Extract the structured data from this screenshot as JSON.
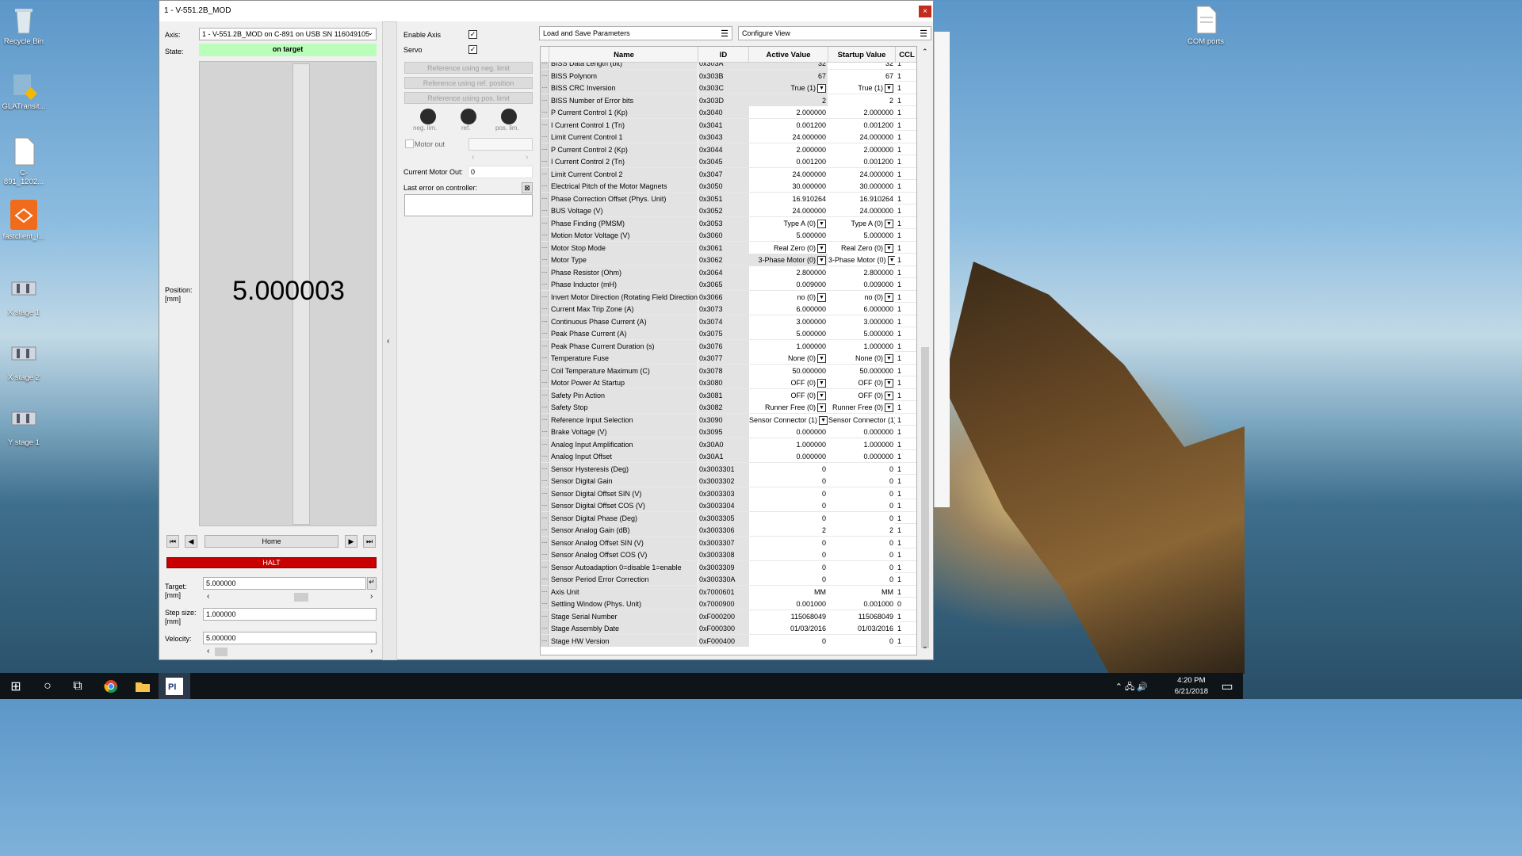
{
  "desktop": {
    "icons": [
      {
        "label": "Recycle Bin",
        "icon": "recycle-bin-icon"
      },
      {
        "label": "GLATransit...",
        "icon": "app-icon"
      },
      {
        "label": "C-891_1202...",
        "icon": "file-icon"
      },
      {
        "label": "fastclient_i...",
        "icon": "app-icon"
      },
      {
        "label": "X stage 1",
        "icon": "stage-icon"
      },
      {
        "label": "X stage 2",
        "icon": "stage-icon"
      },
      {
        "label": "Y stage 1",
        "icon": "stage-icon"
      }
    ],
    "com_ports": "COM ports"
  },
  "window": {
    "title": "1 - V-551.2B_MOD",
    "close": "×"
  },
  "axis": {
    "label": "Axis:",
    "value": "1 - V-551.2B_MOD on C-891 on USB SN 116049105"
  },
  "state": {
    "label": "State:",
    "value": "on target",
    "color": "#b9ffb9"
  },
  "position": {
    "label": "Position:",
    "unit": "[mm]",
    "value": "5.000003"
  },
  "nav": {
    "home": "Home"
  },
  "halt": {
    "label": "HALT",
    "color": "#c80000"
  },
  "target": {
    "label": "Target:",
    "unit": "[mm]",
    "value": "5.000000"
  },
  "step": {
    "label": "Step size:",
    "unit": "[mm]",
    "value": "1.000000"
  },
  "velocity": {
    "label": "Velocity:",
    "value": "5.000000"
  },
  "controls": {
    "enable_axis": "Enable Axis",
    "servo": "Servo",
    "ref_neg": "Reference using neg. limit",
    "ref_pos_ref": "Reference using ref. position",
    "ref_pos": "Reference using pos. limit",
    "led_neg": "neg. lim.",
    "led_ref": "ref.",
    "led_pos": "pos. lim.",
    "motor_out": "Motor out",
    "current_motor_out_label": "Current Motor Out:",
    "current_motor_out": "0",
    "last_error": "Last error on controller:"
  },
  "panels": {
    "load_save": "Load and Save Parameters",
    "configure": "Configure View"
  },
  "grid": {
    "headers": {
      "name": "Name",
      "id": "ID",
      "active": "Active Value",
      "startup": "Startup Value",
      "ccl": "CCL"
    },
    "rows": [
      {
        "n": "BISS Data Length (bit)",
        "id": "0x303A",
        "a": "32",
        "s": "32",
        "c": "1"
      },
      {
        "n": "BISS Polynom",
        "id": "0x303B",
        "a": "67",
        "s": "67",
        "c": "1"
      },
      {
        "n": "BISS CRC Inversion",
        "id": "0x303C",
        "a": "True (1)",
        "s": "True (1)",
        "c": "1",
        "dd": true
      },
      {
        "n": "BISS Number of Error bits",
        "id": "0x303D",
        "a": "2",
        "s": "2",
        "c": "1"
      },
      {
        "n": "P Current Control 1 (Kp)",
        "id": "0x3040",
        "a": "2.000000",
        "s": "2.000000",
        "c": "1",
        "w": true
      },
      {
        "n": "I Current Control 1 (Tn)",
        "id": "0x3041",
        "a": "0.001200",
        "s": "0.001200",
        "c": "1",
        "w": true
      },
      {
        "n": "Limit Current Control 1",
        "id": "0x3043",
        "a": "24.000000",
        "s": "24.000000",
        "c": "1",
        "w": true
      },
      {
        "n": "P Current Control 2 (Kp)",
        "id": "0x3044",
        "a": "2.000000",
        "s": "2.000000",
        "c": "1",
        "w": true
      },
      {
        "n": "I Current Control 2 (Tn)",
        "id": "0x3045",
        "a": "0.001200",
        "s": "0.001200",
        "c": "1",
        "w": true
      },
      {
        "n": "Limit Current Control 2",
        "id": "0x3047",
        "a": "24.000000",
        "s": "24.000000",
        "c": "1",
        "w": true
      },
      {
        "n": "Electrical Pitch of the Motor Magnets",
        "id": "0x3050",
        "a": "30.000000",
        "s": "30.000000",
        "c": "1",
        "w": true
      },
      {
        "n": "Phase Correction Offset (Phys. Unit)",
        "id": "0x3051",
        "a": "16.910264",
        "s": "16.910264",
        "c": "1",
        "w": true
      },
      {
        "n": "BUS Voltage (V)",
        "id": "0x3052",
        "a": "24.000000",
        "s": "24.000000",
        "c": "1",
        "w": true
      },
      {
        "n": "Phase Finding (PMSM)",
        "id": "0x3053",
        "a": "Type A (0)",
        "s": "Type A (0)",
        "c": "1",
        "dd": true,
        "w": true
      },
      {
        "n": "Motion Motor Voltage (V)",
        "id": "0x3060",
        "a": "5.000000",
        "s": "5.000000",
        "c": "1",
        "w": true
      },
      {
        "n": "Motor Stop Mode",
        "id": "0x3061",
        "a": "Real Zero (0)",
        "s": "Real Zero (0)",
        "c": "1",
        "dd": true,
        "w": true
      },
      {
        "n": "Motor Type",
        "id": "0x3062",
        "a": "3-Phase Motor (0)",
        "s": "3-Phase Motor (0)",
        "c": "1",
        "dd": true
      },
      {
        "n": "Phase Resistor (Ohm)",
        "id": "0x3064",
        "a": "2.800000",
        "s": "2.800000",
        "c": "1",
        "w": true
      },
      {
        "n": "Phase Inductor (mH)",
        "id": "0x3065",
        "a": "0.009000",
        "s": "0.009000",
        "c": "1",
        "w": true
      },
      {
        "n": "Invert Motor Direction (Rotating Field Direction)",
        "id": "0x3066",
        "a": "no (0)",
        "s": "no (0)",
        "c": "1",
        "dd": true,
        "w": true
      },
      {
        "n": "Current Max Trip Zone (A)",
        "id": "0x3073",
        "a": "6.000000",
        "s": "6.000000",
        "c": "1",
        "w": true
      },
      {
        "n": "Continuous Phase Current (A)",
        "id": "0x3074",
        "a": "3.000000",
        "s": "3.000000",
        "c": "1",
        "w": true
      },
      {
        "n": "Peak Phase Current (A)",
        "id": "0x3075",
        "a": "5.000000",
        "s": "5.000000",
        "c": "1",
        "w": true
      },
      {
        "n": "Peak Phase Current Duration (s)",
        "id": "0x3076",
        "a": "1.000000",
        "s": "1.000000",
        "c": "1",
        "w": true
      },
      {
        "n": "Temperature Fuse",
        "id": "0x3077",
        "a": "None (0)",
        "s": "None (0)",
        "c": "1",
        "dd": true,
        "w": true
      },
      {
        "n": "Coil Temperature Maximum (C)",
        "id": "0x3078",
        "a": "50.000000",
        "s": "50.000000",
        "c": "1",
        "w": true
      },
      {
        "n": "Motor Power At Startup",
        "id": "0x3080",
        "a": "OFF (0)",
        "s": "OFF (0)",
        "c": "1",
        "dd": true,
        "w": true
      },
      {
        "n": "Safety Pin Action",
        "id": "0x3081",
        "a": "OFF (0)",
        "s": "OFF (0)",
        "c": "1",
        "dd": true,
        "w": true
      },
      {
        "n": "Safety Stop",
        "id": "0x3082",
        "a": "Runner Free (0)",
        "s": "Runner Free (0)",
        "c": "1",
        "dd": true,
        "w": true
      },
      {
        "n": "Reference Input Selection",
        "id": "0x3090",
        "a": "Sensor Connector (1)",
        "s": "Sensor Connector (1)",
        "c": "1",
        "dd": true,
        "w": true
      },
      {
        "n": "Brake Voltage (V)",
        "id": "0x3095",
        "a": "0.000000",
        "s": "0.000000",
        "c": "1",
        "w": true
      },
      {
        "n": "Analog Input Amplification",
        "id": "0x30A0",
        "a": "1.000000",
        "s": "1.000000",
        "c": "1",
        "w": true
      },
      {
        "n": "Analog Input Offset",
        "id": "0x30A1",
        "a": "0.000000",
        "s": "0.000000",
        "c": "1",
        "w": true
      },
      {
        "n": "Sensor Hysteresis (Deg)",
        "id": "0x3003301",
        "a": "0",
        "s": "0",
        "c": "1",
        "w": true
      },
      {
        "n": "Sensor Digital Gain",
        "id": "0x3003302",
        "a": "0",
        "s": "0",
        "c": "1",
        "w": true
      },
      {
        "n": "Sensor Digital Offset SIN (V)",
        "id": "0x3003303",
        "a": "0",
        "s": "0",
        "c": "1",
        "w": true
      },
      {
        "n": "Sensor Digital Offset COS (V)",
        "id": "0x3003304",
        "a": "0",
        "s": "0",
        "c": "1",
        "w": true
      },
      {
        "n": "Sensor Digital Phase (Deg)",
        "id": "0x3003305",
        "a": "0",
        "s": "0",
        "c": "1",
        "w": true
      },
      {
        "n": "Sensor Analog Gain (dB)",
        "id": "0x3003306",
        "a": "2",
        "s": "2",
        "c": "1",
        "w": true
      },
      {
        "n": "Sensor Analog Offset SIN (V)",
        "id": "0x3003307",
        "a": "0",
        "s": "0",
        "c": "1",
        "w": true
      },
      {
        "n": "Sensor Analog Offset COS (V)",
        "id": "0x3003308",
        "a": "0",
        "s": "0",
        "c": "1",
        "w": true
      },
      {
        "n": "Sensor Autoadaption     0=disable     1=enable",
        "id": "0x3003309",
        "a": "0",
        "s": "0",
        "c": "1",
        "w": true
      },
      {
        "n": "Sensor Period Error Correction",
        "id": "0x300330A",
        "a": "0",
        "s": "0",
        "c": "1",
        "w": true
      },
      {
        "n": "Axis Unit",
        "id": "0x7000601",
        "a": "MM",
        "s": "MM",
        "c": "1",
        "w": true
      },
      {
        "n": "Settling Window (Phys. Unit)",
        "id": "0x7000900",
        "a": "0.001000",
        "s": "0.001000",
        "c": "0",
        "w": true
      },
      {
        "n": "Stage Serial Number",
        "id": "0xF000200",
        "a": "115068049",
        "s": "115068049",
        "c": "1",
        "w": true
      },
      {
        "n": "Stage Assembly Date",
        "id": "0xF000300",
        "a": "01/03/2016",
        "s": "01/03/2016",
        "c": "1",
        "w": true
      },
      {
        "n": "Stage HW Version",
        "id": "0xF000400",
        "a": "0",
        "s": "0",
        "c": "1",
        "w": true
      }
    ]
  },
  "taskbar": {
    "time": "4:20 PM",
    "date": "6/21/2018"
  }
}
